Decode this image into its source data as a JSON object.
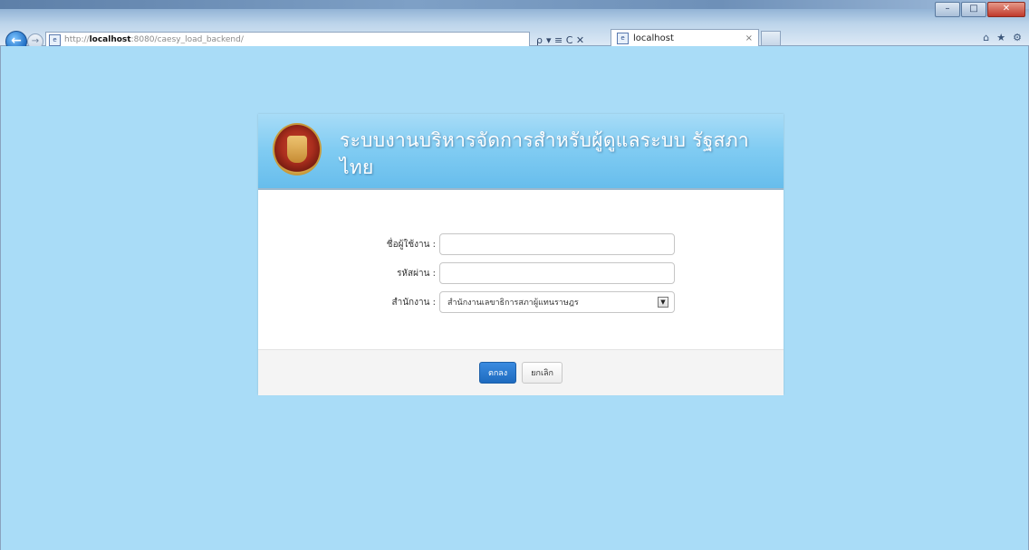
{
  "browser": {
    "url_prefix": "http://",
    "url_host": "localhost",
    "url_rest": ":8080/caesy_load_backend/",
    "tab_title": "localhost",
    "back_icon": "back-arrow-icon",
    "forward_icon": "forward-arrow-icon",
    "search_glyph": "ρ",
    "tool_glyphs": "▾ ≡ C ✕",
    "tab_close": "×",
    "chrome_icons": [
      "⌂",
      "★",
      "⚙"
    ],
    "window_buttons": [
      "–",
      "□",
      "✕"
    ]
  },
  "login": {
    "title": "ระบบงานบริหารจัดการสำหรับผู้ดูแลระบบ รัฐสภาไทย",
    "username_label": "ชื่อผู้ใช้งาน :",
    "username_value": "",
    "password_label": "รหัสผ่าน :",
    "password_value": "",
    "office_label": "สำนักงาน :",
    "office_selected": "สำนักงานเลขาธิการสภาผู้แทนราษฎร",
    "ok_button": "ตกลง",
    "cancel_button": "ยกเลิก"
  }
}
